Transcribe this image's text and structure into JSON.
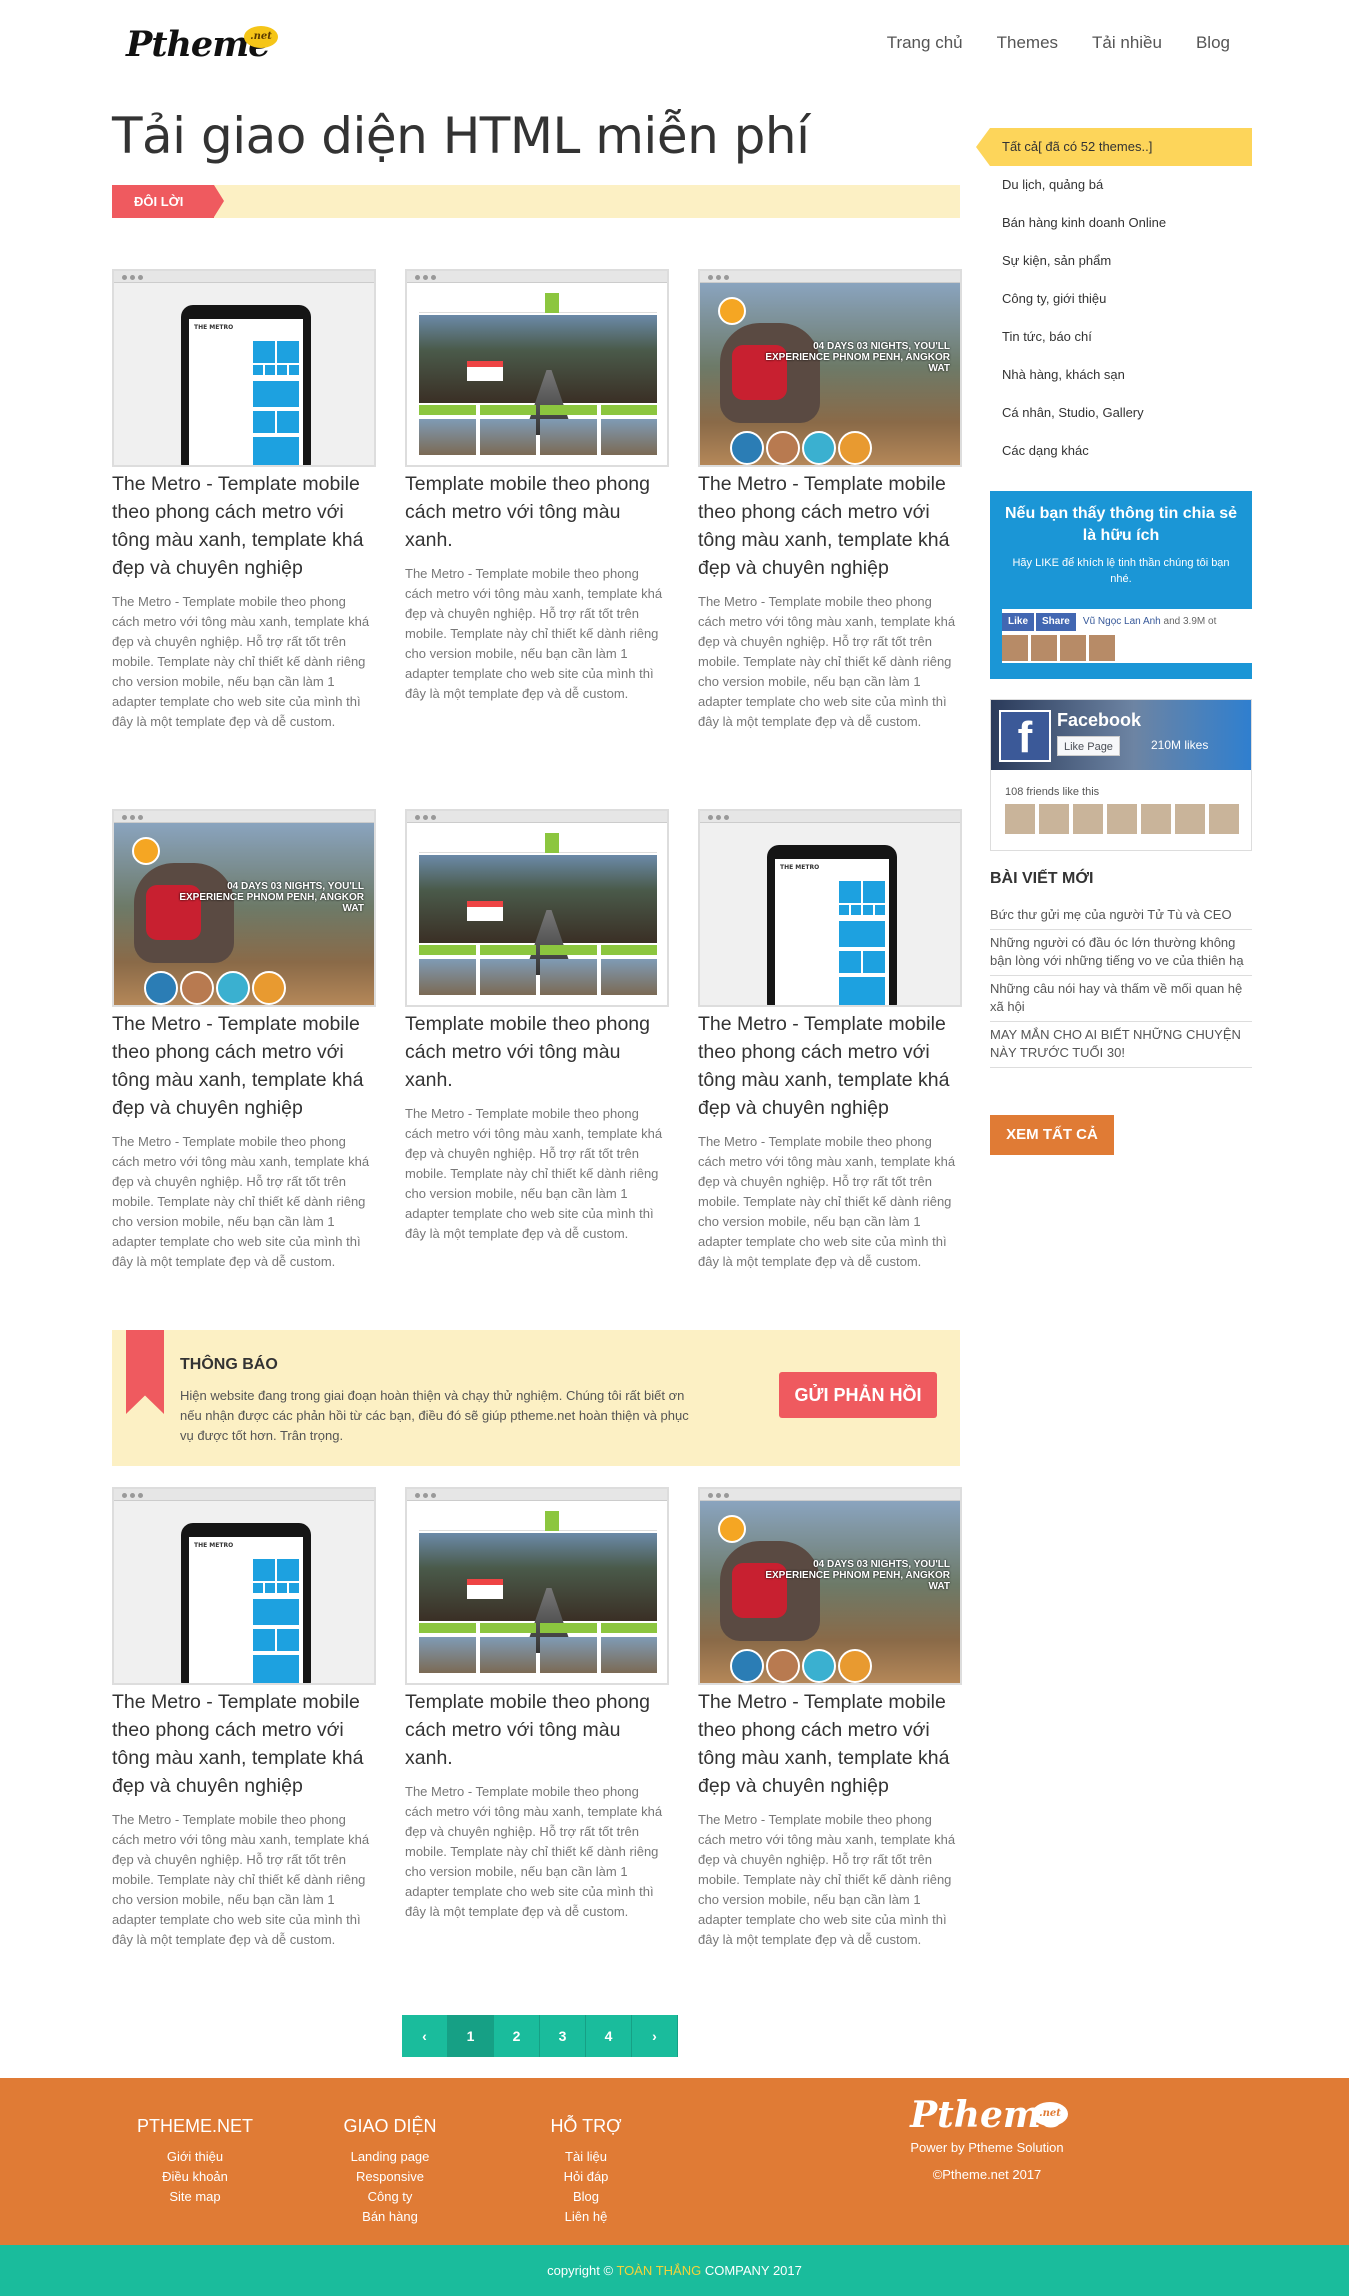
{
  "header": {
    "logo_text": "Ptheme",
    "logo_badge": ".net",
    "nav": [
      "Trang chủ",
      "Themes",
      "Tải nhiều",
      "Blog"
    ]
  },
  "main": {
    "title": "Tải giao diện HTML miễn phí",
    "intro_tag": "ĐÔI LỜI"
  },
  "cards": [
    {
      "type": "phone",
      "title": "The Metro - Template mobile theo phong cách metro với tông màu xanh, template khá đẹp và chuyên nghiệp",
      "desc": "The Metro - Template mobile theo phong cách metro với tông màu xanh, template khá đẹp và chuyên nghiệp. Hỗ trợ rất tốt trên mobile. Template này chỉ thiết kế dành riêng cho version mobile, nếu bạn cần làm 1 adapter template cho web site của mình thì đây là một template đẹp và dễ custom."
    },
    {
      "type": "rail",
      "title": "Template mobile theo phong cách metro với tông màu xanh.",
      "desc": "The Metro - Template mobile theo phong cách metro với tông màu xanh, template khá đẹp và chuyên nghiệp. Hỗ trợ rất tốt trên mobile. Template này chỉ thiết kế dành riêng cho version mobile, nếu bạn cần làm 1 adapter template cho web site của mình thì đây là một template đẹp và dễ custom."
    },
    {
      "type": "ele",
      "title": "The Metro - Template mobile theo phong cách metro với tông màu xanh, template khá đẹp và chuyên nghiệp",
      "desc": "The Metro - Template mobile theo phong cách metro với tông màu xanh, template khá đẹp và chuyên nghiệp. Hỗ trợ rất tốt trên mobile. Template này chỉ thiết kế dành riêng cho version mobile, nếu bạn cần làm 1 adapter template cho web site của mình thì đây là một template đẹp và dễ custom."
    },
    {
      "type": "ele",
      "title": "The Metro - Template mobile theo phong cách metro với tông màu xanh, template khá đẹp và chuyên nghiệp",
      "desc": "The Metro - Template mobile theo phong cách metro với tông màu xanh, template khá đẹp và chuyên nghiệp. Hỗ trợ rất tốt trên mobile. Template này chỉ thiết kế dành riêng cho version mobile, nếu bạn cần làm 1 adapter template cho web site của mình thì đây là một template đẹp và dễ custom."
    },
    {
      "type": "rail",
      "title": "Template mobile theo phong cách metro với tông màu xanh.",
      "desc": "The Metro - Template mobile theo phong cách metro với tông màu xanh, template khá đẹp và chuyên nghiệp. Hỗ trợ rất tốt trên mobile. Template này chỉ thiết kế dành riêng cho version mobile, nếu bạn cần làm 1 adapter template cho web site của mình thì đây là một template đẹp và dễ custom."
    },
    {
      "type": "phone",
      "title": "The Metro - Template mobile theo phong cách metro với tông màu xanh, template khá đẹp và chuyên nghiệp",
      "desc": "The Metro - Template mobile theo phong cách metro với tông màu xanh, template khá đẹp và chuyên nghiệp. Hỗ trợ rất tốt trên mobile. Template này chỉ thiết kế dành riêng cho version mobile, nếu bạn cần làm 1 adapter template cho web site của mình thì đây là một template đẹp và dễ custom."
    },
    {
      "type": "phone",
      "title": "The Metro - Template mobile theo phong cách metro với tông màu xanh, template khá đẹp và chuyên nghiệp",
      "desc": "The Metro - Template mobile theo phong cách metro với tông màu xanh, template khá đẹp và chuyên nghiệp. Hỗ trợ rất tốt trên mobile. Template này chỉ thiết kế dành riêng cho version mobile, nếu bạn cần làm 1 adapter template cho web site của mình thì đây là một template đẹp và dễ custom."
    },
    {
      "type": "rail",
      "title": "Template mobile theo phong cách metro với tông màu xanh.",
      "desc": "The Metro - Template mobile theo phong cách metro với tông màu xanh, template khá đẹp và chuyên nghiệp. Hỗ trợ rất tốt trên mobile. Template này chỉ thiết kế dành riêng cho version mobile, nếu bạn cần làm 1 adapter template cho web site của mình thì đây là một template đẹp và dễ custom."
    },
    {
      "type": "ele",
      "title": "The Metro - Template mobile theo phong cách metro với tông màu xanh, template khá đẹp và chuyên nghiệp",
      "desc": "The Metro - Template mobile theo phong cách metro với tông màu xanh, template khá đẹp và chuyên nghiệp. Hỗ trợ rất tốt trên mobile. Template này chỉ thiết kế dành riêng cho version mobile, nếu bạn cần làm 1 adapter template cho web site của mình thì đây là một template đẹp và dễ custom."
    }
  ],
  "thumb_text": {
    "phone_title": "THE METRO",
    "ele_caption": "04 DAYS 03 NIGHTS, YOU'LL EXPERIENCE PHNOM PENH, ANGKOR WAT"
  },
  "sidebar": {
    "categories": [
      "Tất cả[ đã có 52 themes..]",
      "Du lịch, quảng bá",
      "Bán hàng kinh doanh Online",
      "Sự kiện, sản phẩm",
      "Công ty, giới thiệu",
      "Tin tức, báo chí",
      "Nhà hàng, khách sạn",
      "Cá nhân, Studio, Gallery",
      "Các dạng khác"
    ],
    "share_title": "Nếu bạn thấy thông tin chia sẻ là hữu ích",
    "share_text": "Hãy LIKE để khích lệ tinh thần chúng tôi bạn nhé.",
    "like_label": "Like",
    "share_label": "Share",
    "like_line_name": "Vũ Ngọc Lan Anh",
    "like_line_rest": "and 3.9M ot",
    "fb_name": "Facebook",
    "fb_like_page": "Like Page",
    "fb_likes": "210M likes",
    "fb_friends": "108 friends like this",
    "new_posts_title": "Bài viết mới",
    "posts": [
      "Bức thư gửi mẹ của người Tử Tù và CEO",
      "Những người có đầu óc lớn thường không bận lòng với những tiếng vo ve của thiên hạ",
      "Những câu nói hay và thấm về mối quan hệ xã hội",
      "MAY MẮN CHO AI BIẾT NHỮNG CHUYỆN NÀY TRƯỚC TUỔI 30!"
    ],
    "see_all": "XEM TẤT CẢ"
  },
  "notice": {
    "title": "THÔNG BÁO",
    "text": "Hiện website đang trong giai đoạn hoàn thiện và chạy thử nghiệm. Chúng tôi rất biết ơn nếu nhận được các phản hồi từ các bạn, điều đó sẽ giúp ptheme.net hoàn thiện và phục vụ được tốt hơn. Trân trọng.",
    "button": "GỬI PHẢN HỒI"
  },
  "pagination": {
    "prev": "‹",
    "pages": [
      "1",
      "2",
      "3",
      "4"
    ],
    "next": "›",
    "current": "1"
  },
  "footer": {
    "columns": [
      {
        "title": "PTHEME.NET",
        "links": [
          "Giới thiệu",
          "Điều khoản",
          "Site map"
        ]
      },
      {
        "title": "GIAO DIỆN",
        "links": [
          "Landing page",
          "Responsive",
          "Công ty",
          "Bán hàng"
        ]
      },
      {
        "title": "HỖ TRỢ",
        "links": [
          "Tài liệu",
          "Hỏi đáp",
          "Blog",
          "Liên hệ"
        ]
      }
    ],
    "logo_text": "Ptheme",
    "logo_badge": ".net",
    "power": "Power by Ptheme Solution",
    "copy_right": "©Ptheme.net 2017"
  },
  "copyright": {
    "prefix": "copyright © ",
    "highlight": "TOÀN THẮNG",
    "suffix": " COMPANY 2017"
  },
  "colors": {
    "accent_orange": "#e07b35",
    "accent_teal": "#1abc9c",
    "accent_red": "#ef5a5f",
    "accent_yellow": "#fdd55a",
    "fb_blue": "#1b96d6"
  }
}
